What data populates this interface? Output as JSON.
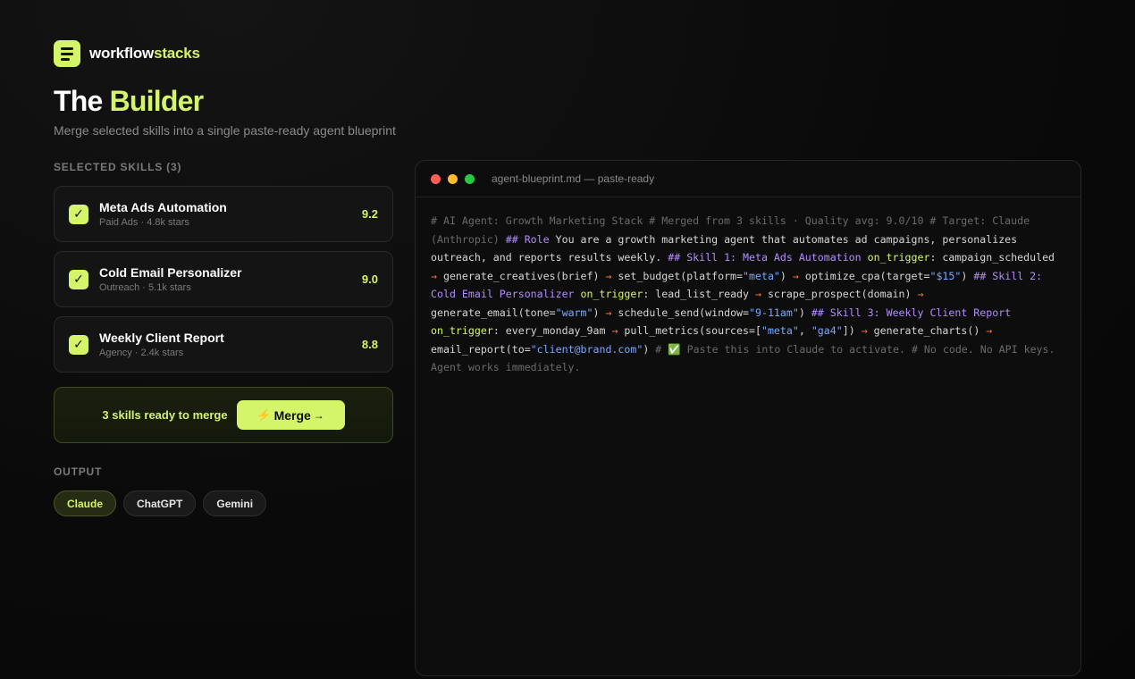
{
  "brand": {
    "name_part1": "workflow",
    "name_part2": "stacks"
  },
  "page": {
    "title_part1": "The ",
    "title_part2": "Builder",
    "subtitle": "Merge selected skills into a single paste-ready agent blueprint"
  },
  "selected_skills": {
    "label": "SELECTED SKILLS (3)",
    "items": [
      {
        "name": "Meta Ads Automation",
        "meta": "Paid Ads · 4.8k stars",
        "score": "9.2",
        "checked": true
      },
      {
        "name": "Cold Email Personalizer",
        "meta": "Outreach · 5.1k stars",
        "score": "9.0",
        "checked": true
      },
      {
        "name": "Weekly Client Report",
        "meta": "Agency · 2.4k stars",
        "score": "8.8",
        "checked": true
      }
    ]
  },
  "merge": {
    "status": "3 skills ready to merge",
    "button_icon": "⚡",
    "button_label": "Merge",
    "button_arrow": "→"
  },
  "output": {
    "label": "OUTPUT",
    "options": [
      "Claude",
      "ChatGPT",
      "Gemini"
    ],
    "selected": "Claude"
  },
  "editor": {
    "filename": "agent-blueprint.md — paste-ready",
    "tokens": [
      {
        "t": "cm",
        "v": "# AI Agent: Growth Marketing Stack # Merged from 3 skills · Quality avg: 9.0/10 # Target: Claude (Anthropic) "
      },
      {
        "t": "h",
        "v": "## Role"
      },
      {
        "t": "tx",
        "v": " You are a growth marketing agent that automates ad campaigns, personalizes outreach, and reports results weekly. "
      },
      {
        "t": "h",
        "v": "## Skill 1: Meta Ads Automation"
      },
      {
        "t": "tx",
        "v": " "
      },
      {
        "t": "k",
        "v": "on_trigger"
      },
      {
        "t": "tx",
        "v": ": campaign_scheduled "
      },
      {
        "t": "ar",
        "v": "→"
      },
      {
        "t": "tx",
        "v": " generate_creatives(brief) "
      },
      {
        "t": "ar",
        "v": "→"
      },
      {
        "t": "tx",
        "v": " set_budget(platform="
      },
      {
        "t": "s",
        "v": "\"meta\""
      },
      {
        "t": "tx",
        "v": ") "
      },
      {
        "t": "ar",
        "v": "→"
      },
      {
        "t": "tx",
        "v": " optimize_cpa(target="
      },
      {
        "t": "s",
        "v": "\"$15\""
      },
      {
        "t": "tx",
        "v": ") "
      },
      {
        "t": "h",
        "v": "## Skill 2: Cold Email Personalizer"
      },
      {
        "t": "tx",
        "v": " "
      },
      {
        "t": "k",
        "v": "on_trigger"
      },
      {
        "t": "tx",
        "v": ": lead_list_ready "
      },
      {
        "t": "ar",
        "v": "→"
      },
      {
        "t": "tx",
        "v": " scrape_prospect(domain) "
      },
      {
        "t": "ar",
        "v": "→"
      },
      {
        "t": "tx",
        "v": " generate_email(tone="
      },
      {
        "t": "s",
        "v": "\"warm\""
      },
      {
        "t": "tx",
        "v": ") "
      },
      {
        "t": "ar",
        "v": "→"
      },
      {
        "t": "tx",
        "v": " schedule_send(window="
      },
      {
        "t": "s",
        "v": "\"9-11am\""
      },
      {
        "t": "tx",
        "v": ") "
      },
      {
        "t": "h",
        "v": "## Skill 3: Weekly Client Report"
      },
      {
        "t": "tx",
        "v": " "
      },
      {
        "t": "k",
        "v": "on_trigger"
      },
      {
        "t": "tx",
        "v": ": every_monday_9am "
      },
      {
        "t": "ar",
        "v": "→"
      },
      {
        "t": "tx",
        "v": " pull_metrics(sources=["
      },
      {
        "t": "s",
        "v": "\"meta\""
      },
      {
        "t": "tx",
        "v": ", "
      },
      {
        "t": "s",
        "v": "\"ga4\""
      },
      {
        "t": "tx",
        "v": "]) "
      },
      {
        "t": "ar",
        "v": "→"
      },
      {
        "t": "tx",
        "v": " generate_charts() "
      },
      {
        "t": "ar",
        "v": "→"
      },
      {
        "t": "tx",
        "v": " email_report(to="
      },
      {
        "t": "s",
        "v": "\"client@brand.com\""
      },
      {
        "t": "tx",
        "v": ") "
      },
      {
        "t": "cm",
        "v": "# ✅ Paste this into Claude to activate. # No code. No API keys. Agent works immediately."
      }
    ]
  },
  "colors": {
    "accent": "#d4f56a",
    "heading": "#b38cff",
    "arrow": "#ff7a3d",
    "string": "#7aa8ff",
    "comment": "#6a6a6a"
  }
}
